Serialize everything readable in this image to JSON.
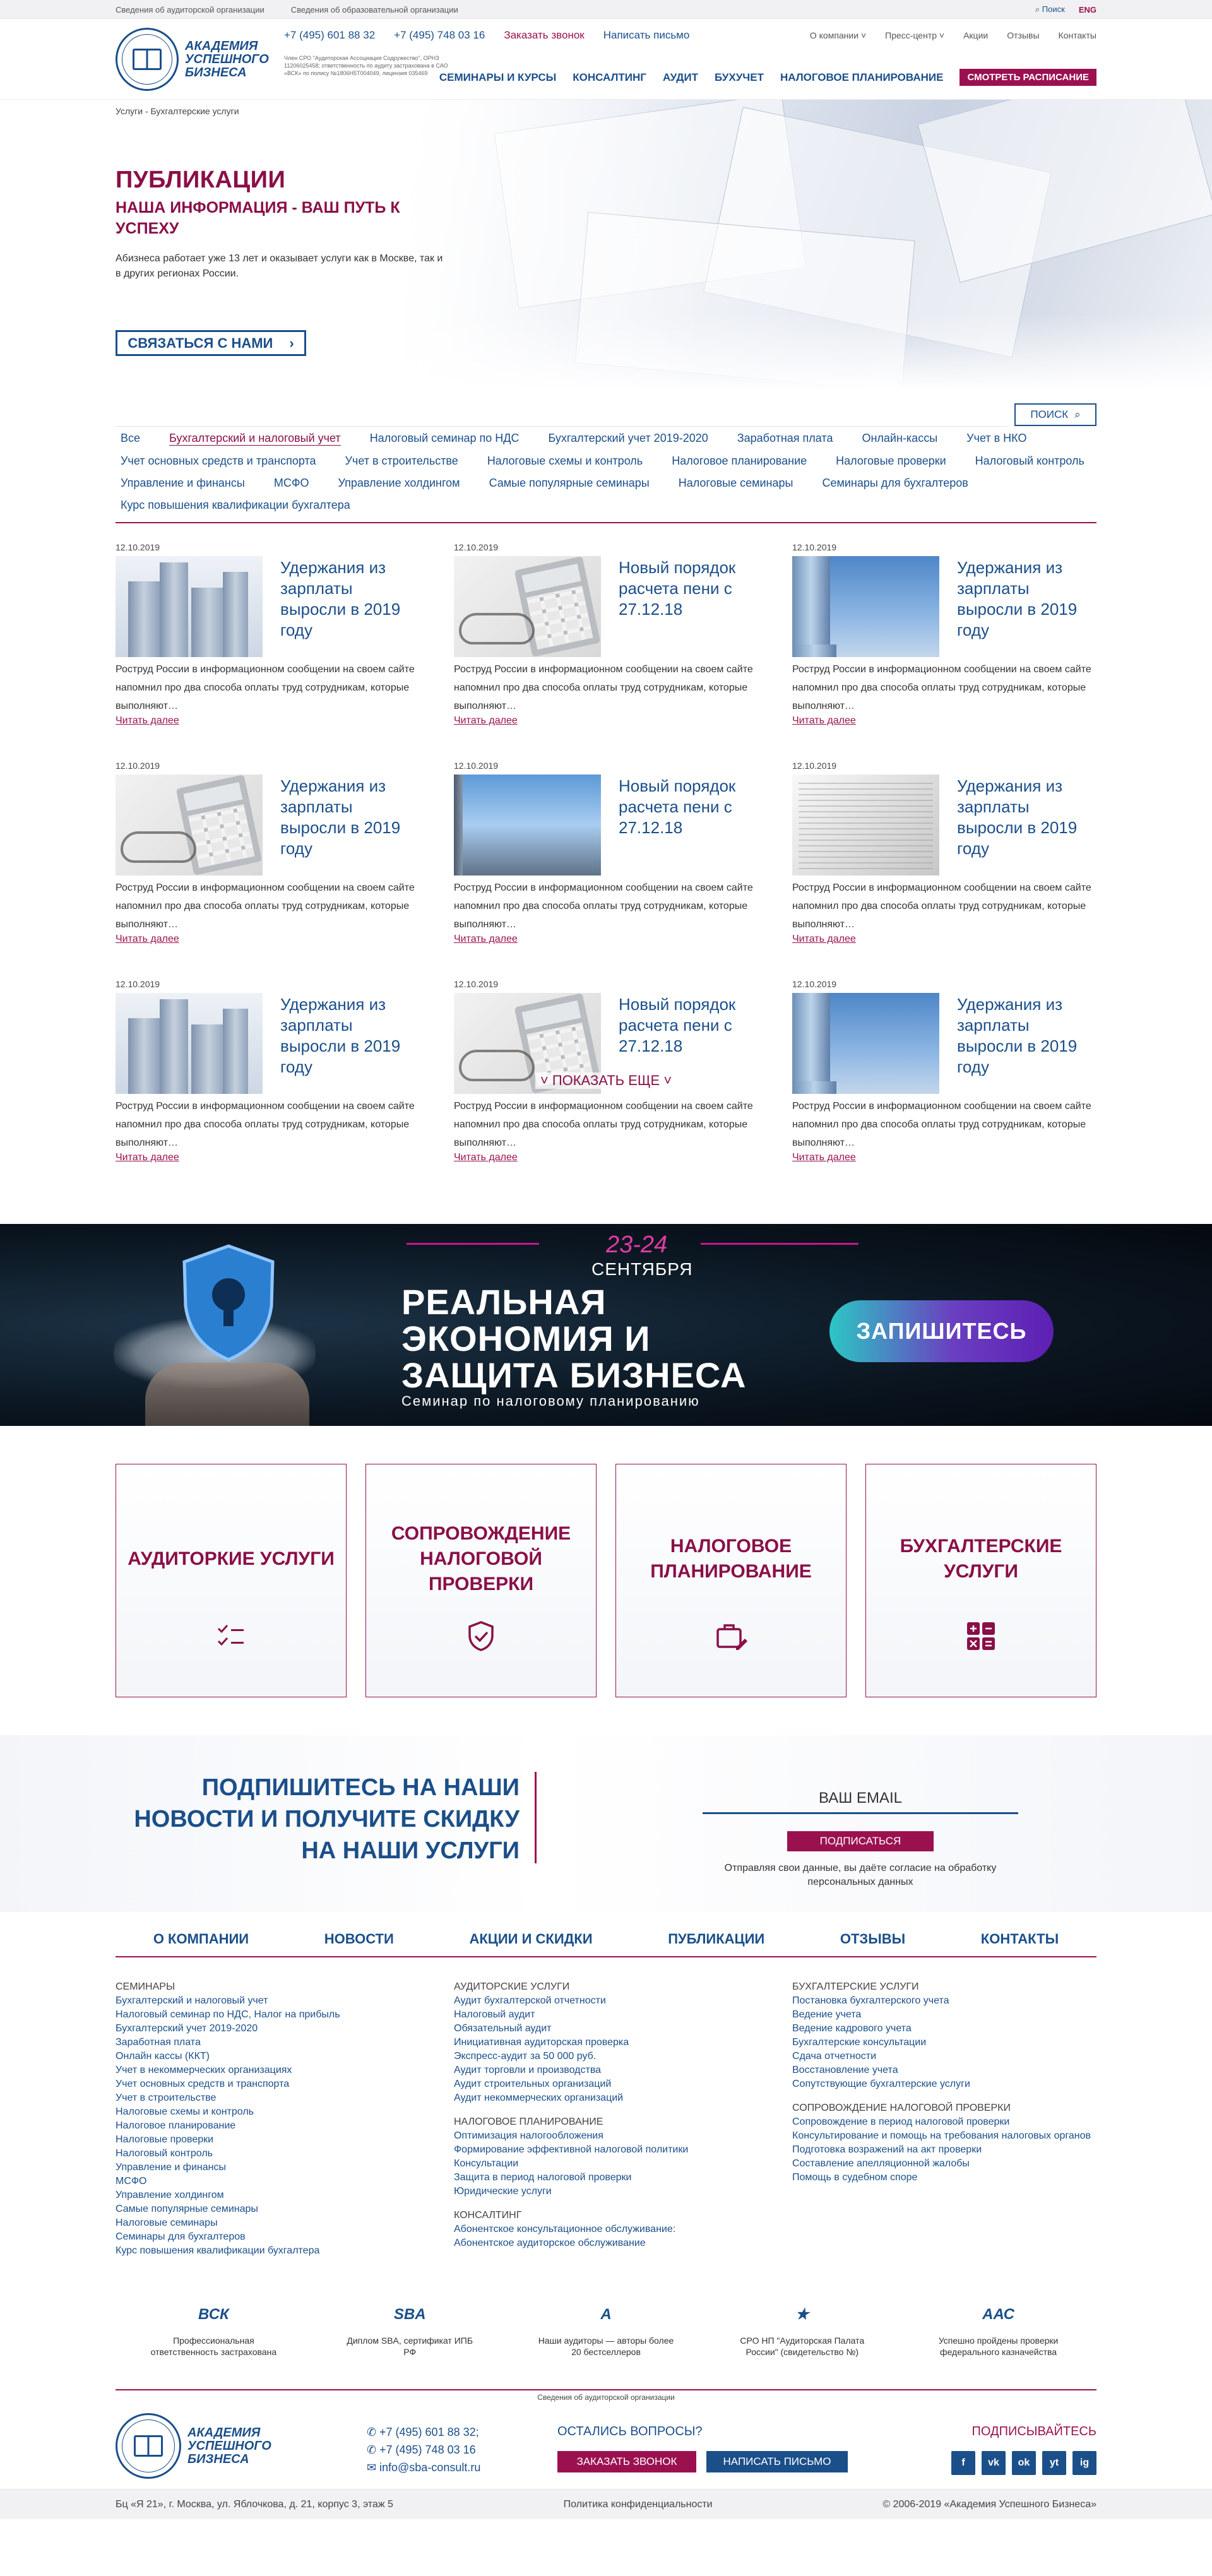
{
  "topbar": {
    "link_audit_org": "Сведения об аудиторской организации",
    "link_edu_org": "Сведения об образовательной организации",
    "search": "Поиск",
    "lang": "ENG"
  },
  "header": {
    "logo_text": "Академия успешного бизнеса",
    "sro_text": "Член СРО \"Аудиторская Ассоциация Содружество\", ОРНЗ 11206025458; ответственность по аудиту застрахована в САО «ВСК» по полису №1806H5T004049, лицензия 035469",
    "phone1": "+7 (495) 601 88 32",
    "phone2": "+7 (495) 748 03 16",
    "call_label": "Заказать звонок",
    "write_label": "Написать письмо",
    "top_menu": [
      "О компании",
      "Пресс-центр",
      "Акции",
      "Отзывы",
      "Контакты"
    ],
    "main_menu": [
      "Семинары и курсы",
      "Консалтинг",
      "Аудит",
      "Бухучет",
      "Налоговое планирование"
    ],
    "schedule_label": "Смотреть расписание"
  },
  "hero": {
    "breadcrumbs": "Услуги - Бухгалтерские услуги",
    "title": "ПУБЛИКАЦИИ",
    "subtitle": "НАША ИНФОРМАЦИЯ - ВАШ ПУТЬ К УСПЕХУ",
    "desc": "Абизнеса работает уже 13 лет и оказывает услуги как в Москве, так и в других регионах России.",
    "cta": "Связаться с нами"
  },
  "search": {
    "button": "Поиск"
  },
  "filters": [
    "Все",
    "Бухгалтерский и налоговый учет",
    "Налоговый семинар по НДС",
    "Бухгалтерский учет 2019-2020",
    "Заработная плата",
    "Онлайн-кассы",
    "Учет в НКО",
    "Учет основных средств и транспорта",
    "Учет в строительстве",
    "Налоговые схемы и контроль",
    "Налоговое планирование",
    "Налоговые проверки",
    "Налоговый контроль",
    "Управление и финансы",
    "МСФО",
    "Управление холдингом",
    "Самые популярные семинары",
    "Налоговые семинары",
    "Семинары для бухгалтеров",
    "Курс повышения квалификации бухгалтера"
  ],
  "news": [
    {
      "date": "12.10.2019",
      "title": "Удержания из зарплаты выросли в 2019 году",
      "text": "Роструд России в информационном сообщении на своем сайте напомнил про два способа оплаты труд сотрудникам, которые выполняют…",
      "more": "Читать далее",
      "img": "building"
    },
    {
      "date": "12.10.2019",
      "title": "Новый порядок расчета пени с 27.12.18",
      "text": "Роструд России в информационном сообщении на своем сайте напомнил про два способа оплаты труд сотрудникам, которые выполняют…",
      "more": "Читать далее",
      "img": "calculator"
    },
    {
      "date": "12.10.2019",
      "title": "Удержания из зарплаты выросли в 2019 году",
      "text": "Роструд России в информационном сообщении на своем сайте напомнил про два способа оплаты труд сотрудникам, которые выполняют…",
      "more": "Читать далее",
      "img": "skyscrapers"
    },
    {
      "date": "12.10.2019",
      "title": "Удержания из зарплаты выросли в 2019 году",
      "text": "Роструд России в информационном сообщении на своем сайте напомнил про два способа оплаты труд сотрудникам, которые выполняют…",
      "more": "Читать далее",
      "img": "calculator"
    },
    {
      "date": "12.10.2019",
      "title": "Новый порядок расчета пени с 27.12.18",
      "text": "Роструд России в информационном сообщении на своем сайте напомнил про два способа оплаты труд сотрудникам, которые выполняют…",
      "more": "Читать далее",
      "img": "city"
    },
    {
      "date": "12.10.2019",
      "title": "Удержания из зарплаты выросли в 2019 году",
      "text": "Роструд России в информационном сообщении на своем сайте напомнил про два способа оплаты труд сотрудникам, которые выполняют…",
      "more": "Читать далее",
      "img": "newspaper"
    },
    {
      "date": "12.10.2019",
      "title": "Удержания из зарплаты выросли в 2019 году",
      "text": "Роструд России в информационном сообщении на своем сайте напомнил про два способа оплаты труд сотрудникам, которые выполняют…",
      "more": "Читать далее",
      "img": "building"
    },
    {
      "date": "12.10.2019",
      "title": "Новый порядок расчета пени с 27.12.18",
      "text": "Роструд России в информационном сообщении на своем сайте напомнил про два способа оплаты труд сотрудникам, которые выполняют…",
      "more": "Читать далее",
      "img": "calculator"
    },
    {
      "date": "12.10.2019",
      "title": "Удержания из зарплаты выросли в 2019 году",
      "text": "Роструд России в информационном сообщении на своем сайте напомнил про два способа оплаты труд сотрудникам, которые выполняют…",
      "more": "Читать далее",
      "img": "skyscrapers"
    }
  ],
  "show_more": "Показать еще",
  "banner": {
    "dates": "23-24",
    "month": "СЕНТЯБРЯ",
    "headline": "РЕАЛЬНАЯ ЭКОНОМИЯ И ЗАЩИТА БИЗНЕСА",
    "sub": "Семинар по налоговому планированию",
    "button": "Запишитесь"
  },
  "services": [
    {
      "name": "Аудиторкие услуги",
      "icon": "checklist-icon"
    },
    {
      "name": "Сопровождение налоговой проверки",
      "icon": "shield-check-icon"
    },
    {
      "name": "Налоговое планирование",
      "icon": "briefcase-edit-icon"
    },
    {
      "name": "Бухгалтерские услуги",
      "icon": "calculator-icon"
    }
  ],
  "subscribe": {
    "text": "Подпишитесь на наши новости и получите скидку на наши услуги",
    "email_placeholder": "ВАШ EMAIL",
    "button": "Подписаться",
    "note": "Отправляя свои данные, вы даёте согласие на обработку персональных данных"
  },
  "footer_nav": [
    "О компании",
    "Новости",
    "Акции и скидки",
    "Публикации",
    "Отзывы",
    "Контакты"
  ],
  "footer_cols": [
    [
      {
        "hd": "Семинары"
      },
      {
        "t": "Бухгалтерский и налоговый учет"
      },
      {
        "t": "Налоговый семинар по НДС, Налог на прибыль"
      },
      {
        "t": "Бухгалтерский учет 2019-2020"
      },
      {
        "t": "Заработная плата"
      },
      {
        "t": "Онлайн кассы (ККТ)"
      },
      {
        "t": "Учет в некоммерческих организациях"
      },
      {
        "t": "Учет основных средств и транспорта"
      },
      {
        "t": "Учет в строительстве"
      },
      {
        "t": "Налоговые схемы и контроль"
      },
      {
        "t": "Налоговое планирование"
      },
      {
        "t": "Налоговые проверки"
      },
      {
        "t": "Налоговый контроль"
      },
      {
        "t": "Управление и финансы"
      },
      {
        "t": "МСФО"
      },
      {
        "t": "Управление холдингом"
      },
      {
        "t": "Самые популярные семинары"
      },
      {
        "t": "Налоговые семинары"
      },
      {
        "t": "Семинары для бухгалтеров"
      },
      {
        "t": "Курс повышения квалификации бухгалтера"
      }
    ],
    [
      {
        "hd": "Аудиторские услуги"
      },
      {
        "t": "Аудит бухгалтерской отчетности"
      },
      {
        "t": "Налоговый аудит"
      },
      {
        "t": "Обязательный аудит"
      },
      {
        "t": "Инициативная аудиторская проверка"
      },
      {
        "t": "Экспресс-аудит за 50 000 руб."
      },
      {
        "t": "Аудит торговли и производства"
      },
      {
        "t": "Аудит строительных организаций"
      },
      {
        "t": "Аудит некоммерческих организаций"
      },
      {
        "gap": true
      },
      {
        "hd": "Налоговое планирование"
      },
      {
        "t": "Оптимизация налогообложения"
      },
      {
        "t": "Формирование эффективной налоговой политики"
      },
      {
        "t": "Консультации"
      },
      {
        "t": "Защита в период налоговой проверки"
      },
      {
        "t": "Юридические услуги"
      },
      {
        "gap": true
      },
      {
        "hd": "Консалтинг"
      },
      {
        "t": "Абонентское консультационное обслуживание:"
      },
      {
        "t": "Абонентское аудиторское обслуживание"
      }
    ],
    [
      {
        "hd": "Бухгалтерские услуги"
      },
      {
        "t": "Постановка бухгалтерского учета"
      },
      {
        "t": "Ведение учета"
      },
      {
        "t": "Ведение кадрового учета"
      },
      {
        "t": "Бухгалтерские консультации"
      },
      {
        "t": "Сдача отчетности"
      },
      {
        "t": "Восстановление учета"
      },
      {
        "t": "Сопутствующие бухгалтерские услуги"
      },
      {
        "gap": true
      },
      {
        "hd": "Сопровождение налоговой проверки"
      },
      {
        "t": "Сопровождение в период налоговой проверки"
      },
      {
        "t": "Консультирование и помощь на требования налоговых органов"
      },
      {
        "t": "Подготовка возражений на акт проверки"
      },
      {
        "t": "Составление апелляционной жалобы"
      },
      {
        "t": "Помощь в судебном споре"
      }
    ]
  ],
  "partners": [
    {
      "logo": "ВСК",
      "text": "Профессиональная ответственность застрахована"
    },
    {
      "logo": "SBA",
      "text": "Диплом SBA, сертификат ИПБ РФ"
    },
    {
      "logo": "A",
      "text": "Наши аудиторы — авторы более 20 бестселлеров"
    },
    {
      "logo": "★",
      "text": "СРО НП \"Аудиторская Палата России\" (свидетельство №)"
    },
    {
      "logo": "ААС",
      "text": "Успешно пройдены проверки федерального казначейства"
    }
  ],
  "footer": {
    "audit_org": "Сведения об аудиторской организации",
    "phone1": "+7 (495) 601 88 32;",
    "phone2": "+7 (495) 748 03 16",
    "email": "info@sba-consult.ru",
    "question": "Остались вопросы?",
    "call": "Заказать звонок",
    "write": "Написать письмо",
    "subscribe": "Подписывайтесь",
    "socials": [
      "f",
      "vk",
      "ok",
      "yt",
      "ig"
    ],
    "address": "Бц «Я 21», г. Москва, ул. Яблочкова, д. 21, корпус 3, этаж 5",
    "policy": "Политика конфиденциальности",
    "copyright": "© 2006-2019 «Академия Успешного Бизнеса»"
  }
}
